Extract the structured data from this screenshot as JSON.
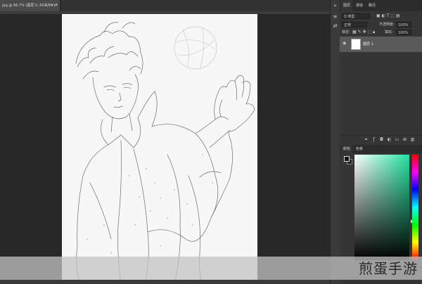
{
  "document_tab": {
    "title": "jpg @ 66.7% (图层 0, RGB/8#) *",
    "close": "×"
  },
  "toolbar": {
    "items": [
      {
        "icon": "collapse-arrows-icon",
        "glyph": "»"
      },
      {
        "icon": "brush-settings-icon",
        "glyph": "≋"
      },
      {
        "icon": "adjust-icon",
        "glyph": "⇄"
      }
    ]
  },
  "layers_panel": {
    "tabs": [
      "图层",
      "通道",
      "路径"
    ],
    "filter": {
      "label": "Q 类型"
    },
    "blend_mode": "正常",
    "opacity": {
      "label": "不透明度:",
      "value": "100%"
    },
    "lock": {
      "label": "锁定:"
    },
    "fill": {
      "label": "填充:",
      "value": "100%"
    },
    "layer": {
      "name": "图层 1"
    }
  },
  "color_panel": {
    "tabs": [
      "颜色",
      "色板"
    ],
    "foreground": "#111111",
    "background": "#222222"
  },
  "watermark": "煎蛋手游",
  "colors": {
    "canvas_bg": "#282828",
    "panel": "#353535",
    "accent_green": "#22e3a0"
  }
}
